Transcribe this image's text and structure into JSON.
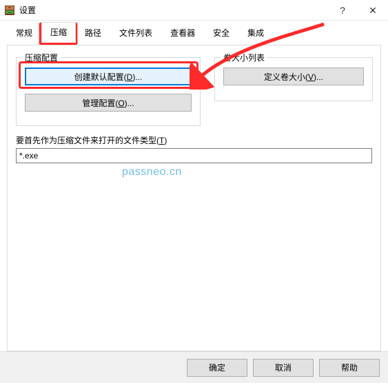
{
  "window": {
    "title": "设置",
    "help_glyph": "?",
    "close_glyph": "✕"
  },
  "tabs": {
    "general": "常规",
    "compression": "压缩",
    "path": "路径",
    "filelist": "文件列表",
    "viewer": "查看器",
    "security": "安全",
    "integration": "集成"
  },
  "group_left": {
    "legend": "压缩配置",
    "create_default_pre": "创建默认配置(",
    "create_default_mn": "D",
    "create_default_post": ")...",
    "manage_pre": "管理配置(",
    "manage_mn": "O",
    "manage_post": ")..."
  },
  "group_right": {
    "legend": "卷大小列表",
    "define_pre": "定义卷大小(",
    "define_mn": "V",
    "define_post": ")..."
  },
  "open_types": {
    "label_pre": "要首先作为压缩文件来打开的文件类型(",
    "label_mn": "T",
    "label_post": ")",
    "value": "*.exe"
  },
  "watermark": "passneo.cn",
  "footer": {
    "ok": "确定",
    "cancel": "取消",
    "help": "帮助"
  }
}
